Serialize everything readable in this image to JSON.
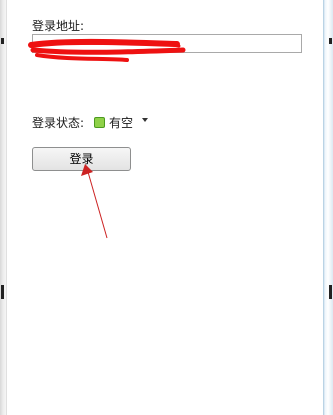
{
  "login_form": {
    "address_label": "登录地址:",
    "address_value": "",
    "status_label": "登录状态:",
    "status_value": "有空",
    "status_icon": "online-status-icon",
    "dropdown_icon": "dropdown-triangle-icon",
    "login_button_label": "登录"
  },
  "colors": {
    "redaction": "#ee1111",
    "annotation_arrow": "#cc2222",
    "status_green": "#8fd148",
    "window_edge": "#a9c8de"
  }
}
